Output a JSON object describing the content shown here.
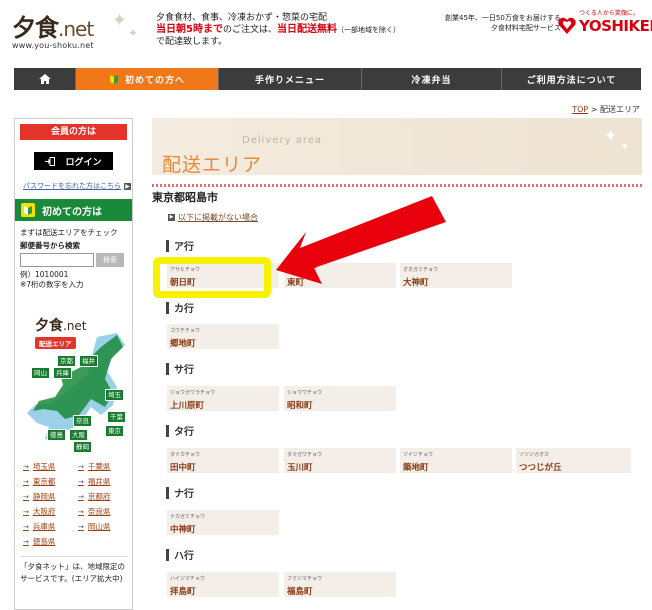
{
  "header": {
    "logo_text": "夕食",
    "logo_net": ".net",
    "logo_url": "www.you-shoku.net",
    "tagline_line1": "夕食食材、食事、冷凍おかず・惣菜の宅配",
    "tagline_red1": "当日朝5時まで",
    "tagline_mid": "のご注文は、",
    "tagline_red2": "当日配送無料",
    "tagline_small": "（一部地域を除く）",
    "tagline_line3": "で配達致します。",
    "corp_line1": "創業45年、一日50万食をお届けする",
    "corp_line2": "夕食材料宅配サービス",
    "brand_small": "つくる人から笑顔に。",
    "brand_name": "YOSHIKEI"
  },
  "nav": {
    "home_icon": "home-icon",
    "items": [
      "初めての方へ",
      "手作りメニュー",
      "冷凍弁当",
      "ご利用方法について"
    ]
  },
  "breadcrumb": {
    "top": "TOP",
    "sep": " > ",
    "current": "配送エリア"
  },
  "sidebar": {
    "member_head": "会員の方は",
    "login_label": "ログイン",
    "password_link": "パスワードを忘れた方はこちら",
    "first_head": "初めての方は",
    "check_text": "まずは配送エリアをチェック",
    "zip_label": "郵便番号から検索",
    "zip_value": "",
    "zip_button": "検索",
    "example_line1": "例）1010001",
    "example_line2": "※7桁の数字を入力",
    "map_logo": "夕食",
    "map_logo_net": ".net",
    "map_badge": "配送エリア",
    "map_tags": [
      "京都",
      "福井",
      "岡山",
      "兵庫",
      "埼玉",
      "千葉",
      "奈良",
      "東京",
      "徳島",
      "大阪",
      "静岡"
    ],
    "prefectures": [
      "埼玉県",
      "千葉県",
      "東京都",
      "福井県",
      "静岡県",
      "京都府",
      "大阪府",
      "奈良県",
      "兵庫県",
      "岡山県",
      "徳島県"
    ],
    "note": "「夕食ネット」は、地域限定のサービスです。(エリア拡大中)"
  },
  "main": {
    "banner_sub": "Delivery area",
    "banner_title": "配送エリア",
    "city": "東京都昭島市",
    "not_found_link": "以下に掲載がない場合",
    "sections": [
      {
        "title": "ア行",
        "towns": [
          {
            "kana": "アサヒチョウ",
            "name": "朝日町"
          },
          {
            "kana": "アズマチョウ",
            "name": "東町"
          },
          {
            "kana": "オオガミチョウ",
            "name": "大神町"
          }
        ]
      },
      {
        "title": "カ行",
        "towns": [
          {
            "kana": "ゴウチチョウ",
            "name": "郷地町"
          }
        ]
      },
      {
        "title": "サ行",
        "towns": [
          {
            "kana": "ジョウガワラチョウ",
            "name": "上川原町"
          },
          {
            "kana": "ショウワチョウ",
            "name": "昭和町"
          }
        ]
      },
      {
        "title": "タ行",
        "towns": [
          {
            "kana": "タナカチョウ",
            "name": "田中町"
          },
          {
            "kana": "タマガワチョウ",
            "name": "玉川町"
          },
          {
            "kana": "ツイジチョウ",
            "name": "築地町"
          },
          {
            "kana": "ツツジガオカ",
            "name": "つつじが丘"
          }
        ]
      },
      {
        "title": "ナ行",
        "towns": [
          {
            "kana": "ナカガミチョウ",
            "name": "中神町"
          }
        ]
      },
      {
        "title": "ハ行",
        "towns": [
          {
            "kana": "ハイジマチョウ",
            "name": "拝島町"
          },
          {
            "kana": "フクジマチョウ",
            "name": "福島町"
          }
        ]
      }
    ]
  },
  "colors": {
    "accent_orange": "#f07818",
    "brand_red": "#d6000f",
    "sidebar_green": "#1a8a3a",
    "highlight_yellow": "#f7f200",
    "arrow_red": "#e8000c"
  }
}
